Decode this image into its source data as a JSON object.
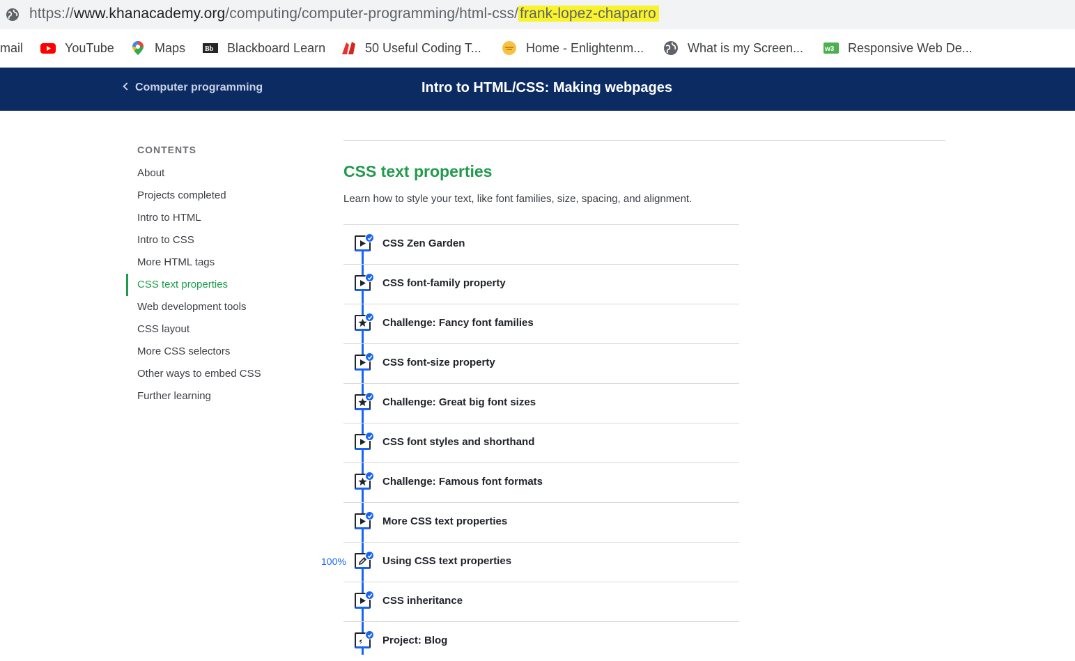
{
  "browser": {
    "url_prefix": "https://",
    "url_domain": "www.khanacademy.org",
    "url_path": "/computing/computer-programming/html-css/",
    "url_highlight": "frank-lopez-chaparro",
    "highlight_color": "#f8f32b",
    "bookmarks": [
      {
        "label": "mail",
        "icon": "none"
      },
      {
        "label": "YouTube",
        "icon": "youtube-icon"
      },
      {
        "label": "Maps",
        "icon": "maps-pin-icon"
      },
      {
        "label": "Blackboard Learn",
        "icon": "blackboard-icon"
      },
      {
        "label": "50 Useful Coding T...",
        "icon": "red-ribbon-icon"
      },
      {
        "label": "Home - Enlightenm...",
        "icon": "enlightenment-icon"
      },
      {
        "label": "What is my Screen...",
        "icon": "globe-icon"
      },
      {
        "label": "Responsive Web De...",
        "icon": "w3-icon"
      }
    ]
  },
  "nav": {
    "back_label": "Computer programming",
    "title": "Intro to HTML/CSS: Making webpages",
    "bg_color": "#0b2b62"
  },
  "sidebar": {
    "heading": "CONTENTS",
    "items": [
      {
        "label": "About",
        "active": false
      },
      {
        "label": "Projects completed",
        "active": false
      },
      {
        "label": "Intro to HTML",
        "active": false
      },
      {
        "label": "Intro to CSS",
        "active": false
      },
      {
        "label": "More HTML tags",
        "active": false
      },
      {
        "label": "CSS text properties",
        "active": true
      },
      {
        "label": "Web development tools",
        "active": false
      },
      {
        "label": "CSS layout",
        "active": false
      },
      {
        "label": "More CSS selectors",
        "active": false
      },
      {
        "label": "Other ways to embed CSS",
        "active": false
      },
      {
        "label": "Further learning",
        "active": false
      }
    ]
  },
  "unit": {
    "title": "CSS text properties",
    "description": "Learn how to style your text, like font families, size, spacing, and alignment.",
    "accent_color": "#1f9b4b",
    "progress_color": "#1865f2",
    "items": [
      {
        "title": "CSS Zen Garden",
        "type": "video-icon",
        "completed": true
      },
      {
        "title": "CSS font-family property",
        "type": "video-icon",
        "completed": true
      },
      {
        "title": "Challenge: Fancy font families",
        "type": "star-icon",
        "completed": true
      },
      {
        "title": "CSS font-size property",
        "type": "video-icon",
        "completed": true
      },
      {
        "title": "Challenge: Great big font sizes",
        "type": "star-icon",
        "completed": true
      },
      {
        "title": "CSS font styles and shorthand",
        "type": "video-icon",
        "completed": true
      },
      {
        "title": "Challenge: Famous font formats",
        "type": "star-icon",
        "completed": true
      },
      {
        "title": "More CSS text properties",
        "type": "video-icon",
        "completed": true
      },
      {
        "title": "Using CSS text properties",
        "type": "pencil-icon",
        "completed": true,
        "score": "100%"
      },
      {
        "title": "CSS inheritance",
        "type": "video-icon",
        "completed": true
      },
      {
        "title": "Project: Blog",
        "type": "rocket-icon",
        "completed": true
      }
    ]
  }
}
